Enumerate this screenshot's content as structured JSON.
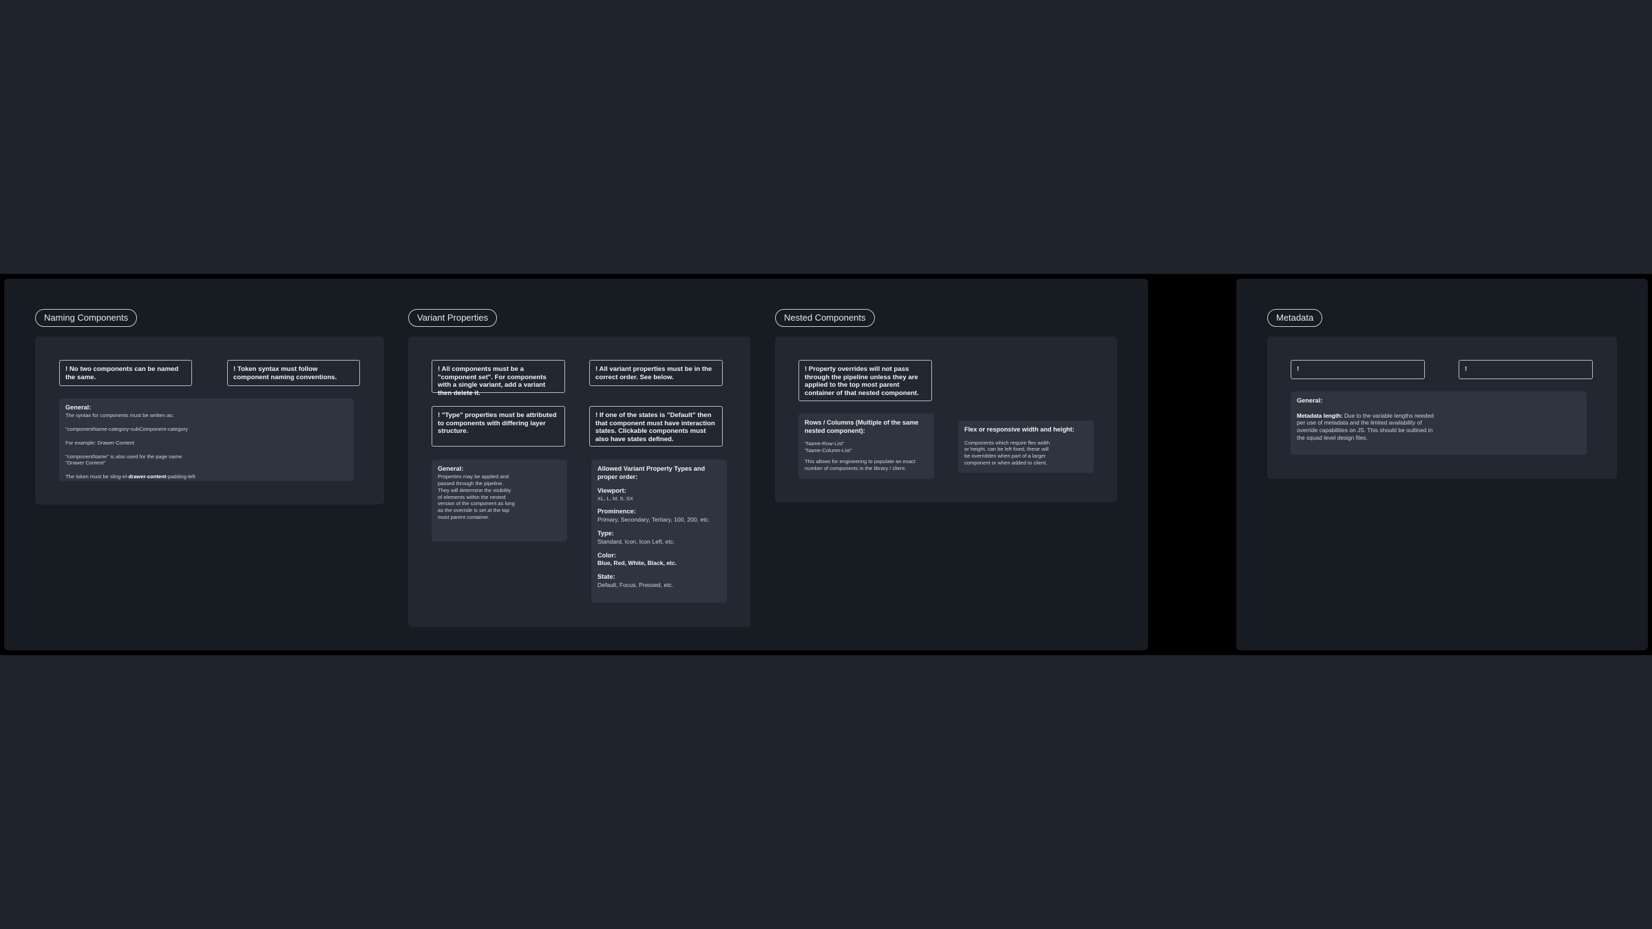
{
  "naming": {
    "title": "Naming Components",
    "rule1": "! No two components can be named the same.",
    "rule2": "! Token syntax must follow component naming conventions.",
    "general_heading": "General:",
    "general_lines": [
      "The syntax for components must be written as:",
      "\"componentName-category-subComponent-category",
      "For example: Drawer-Content",
      "\"componentName\" is also used for the page name.",
      "\"Drawer Content\""
    ],
    "token_prefix": "The token must be sling-el-",
    "token_bold": "drawer-content",
    "token_suffix": "-padding-left"
  },
  "variant": {
    "title": "Variant Properties",
    "rule1": "! All components must be a \"component set\". For components with a single variant, add a variant then delete it.",
    "rule2": "! All variant properties must be in the correct order. See below.",
    "rule3": "! \"Type\" properties must be attributed to components with differing layer structure.",
    "rule4": "! If one of the states is \"Default\" then that component must have interaction states. Clickable components must also have states defined.",
    "general_heading": "General:",
    "general_text": "Properties may be applied and passed through the pipeline. They will determine the visibility of elements within the nested version of the component as long as the override is set at the top most parent container.",
    "allowed_heading": "Allowed Variant Property Types and proper order:",
    "sections": [
      {
        "label": "Viewport:",
        "value": "XL, L, M, S, SX"
      },
      {
        "label": "Prominence:",
        "value": "Primary, Secondary, Tertiary, 100, 200, etc."
      },
      {
        "label": "Type:",
        "value": "Standard, Icon, Icon Left, etc."
      },
      {
        "label": "Color:",
        "value": "Blue, Red, White, Black, etc."
      },
      {
        "label": "State:",
        "value": "Default, Focus, Pressed, etc."
      }
    ]
  },
  "nested": {
    "title": "Nested Components",
    "rule1": "! Property overrides will not pass through the pipeline unless they are applied to the top most parent container of that nested component.",
    "rows_heading": "Rows / Columns (Multiple of the same nested component):",
    "rows_line1": "\"Name-Row-List\"",
    "rows_line2": "\"Name-Column-List\"",
    "rows_text": "This allows for engineering to populate an exact number of components in the library / client.",
    "flex_heading": "Flex or responsive width and height:",
    "flex_text": "Components which require flex width or height, can be left fixed, these will be overridden when part of a larger component or when added to client."
  },
  "metadata": {
    "title": "Metadata",
    "rule1": "!",
    "rule2": "!",
    "general_heading": "General:",
    "length_label": "Metadata length:",
    "length_text": " Due to the variable lengths needed per use of metadata and the limited availability of override capabilities on JS. This should be outlined in the squad level design files."
  }
}
